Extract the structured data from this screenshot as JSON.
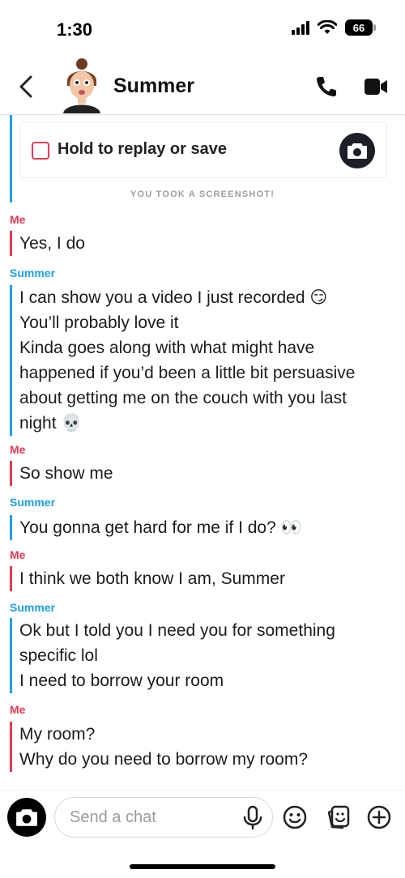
{
  "status_bar": {
    "time": "1:30",
    "battery": "66"
  },
  "header": {
    "contact_name": "Summer"
  },
  "snap": {
    "label": "Hold to replay or save"
  },
  "system_note": "YOU TOOK A SCREENSHOT!",
  "colors": {
    "me": "#e63a55",
    "summer": "#1ea0e6"
  },
  "messages": [
    {
      "sender": "Me",
      "lines": [
        "Yes, I do"
      ]
    },
    {
      "sender": "Summer",
      "lines": [
        "I can show you a video I just recorded 😏",
        "You’ll probably love it",
        "Kinda goes along with what might have",
        "happened if you’d been a little bit persuasive",
        "about getting me on the couch with you last",
        "night 💀"
      ]
    },
    {
      "sender": "Me",
      "lines": [
        "So show me"
      ]
    },
    {
      "sender": "Summer",
      "lines": [
        "You gonna get hard for me if I do? 👀"
      ]
    },
    {
      "sender": "Me",
      "lines": [
        "I think we both know I am, Summer"
      ]
    },
    {
      "sender": "Summer",
      "lines": [
        "Ok but I told you I need you for something",
        "specific lol",
        "I need to borrow your room"
      ]
    },
    {
      "sender": "Me",
      "lines": [
        "My room?",
        "Why do you need to borrow my room?"
      ]
    }
  ],
  "composer": {
    "placeholder": "Send a chat"
  },
  "icons": [
    "back-icon",
    "phone-icon",
    "video-camera-icon",
    "camera-icon",
    "microphone-icon",
    "smiley-icon",
    "sticker-icon",
    "plus-icon"
  ]
}
